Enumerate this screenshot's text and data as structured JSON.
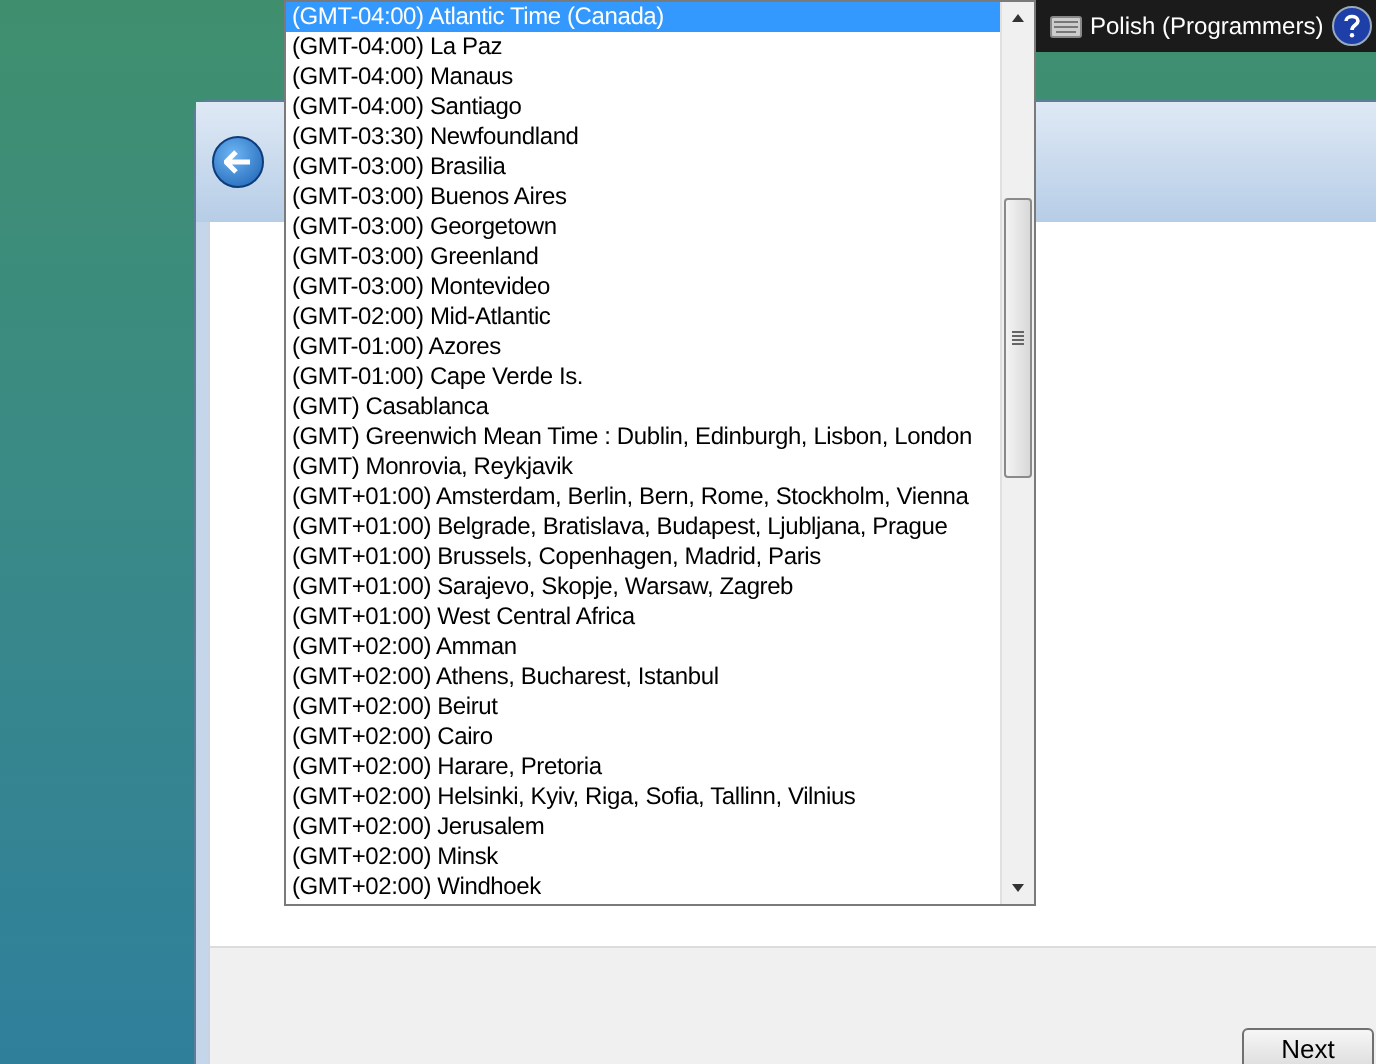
{
  "language_bar": {
    "label": "Polish (Programmers)"
  },
  "timezone_list": {
    "items": [
      {
        "label": "(GMT-04:00) Atlantic Time (Canada)",
        "selected": true
      },
      {
        "label": "(GMT-04:00) La Paz",
        "selected": false
      },
      {
        "label": "(GMT-04:00) Manaus",
        "selected": false
      },
      {
        "label": "(GMT-04:00) Santiago",
        "selected": false
      },
      {
        "label": "(GMT-03:30) Newfoundland",
        "selected": false
      },
      {
        "label": "(GMT-03:00) Brasilia",
        "selected": false
      },
      {
        "label": "(GMT-03:00) Buenos Aires",
        "selected": false
      },
      {
        "label": "(GMT-03:00) Georgetown",
        "selected": false
      },
      {
        "label": "(GMT-03:00) Greenland",
        "selected": false
      },
      {
        "label": "(GMT-03:00) Montevideo",
        "selected": false
      },
      {
        "label": "(GMT-02:00) Mid-Atlantic",
        "selected": false
      },
      {
        "label": "(GMT-01:00) Azores",
        "selected": false
      },
      {
        "label": "(GMT-01:00) Cape Verde Is.",
        "selected": false
      },
      {
        "label": "(GMT) Casablanca",
        "selected": false
      },
      {
        "label": "(GMT) Greenwich Mean Time : Dublin, Edinburgh, Lisbon, London",
        "selected": false
      },
      {
        "label": "(GMT) Monrovia, Reykjavik",
        "selected": false
      },
      {
        "label": "(GMT+01:00) Amsterdam, Berlin, Bern, Rome, Stockholm, Vienna",
        "selected": false
      },
      {
        "label": "(GMT+01:00) Belgrade, Bratislava, Budapest, Ljubljana, Prague",
        "selected": false
      },
      {
        "label": "(GMT+01:00) Brussels, Copenhagen, Madrid, Paris",
        "selected": false
      },
      {
        "label": "(GMT+01:00) Sarajevo, Skopje, Warsaw, Zagreb",
        "selected": false
      },
      {
        "label": "(GMT+01:00) West Central Africa",
        "selected": false
      },
      {
        "label": "(GMT+02:00) Amman",
        "selected": false
      },
      {
        "label": "(GMT+02:00) Athens, Bucharest, Istanbul",
        "selected": false
      },
      {
        "label": "(GMT+02:00) Beirut",
        "selected": false
      },
      {
        "label": "(GMT+02:00) Cairo",
        "selected": false
      },
      {
        "label": "(GMT+02:00) Harare, Pretoria",
        "selected": false
      },
      {
        "label": "(GMT+02:00) Helsinki, Kyiv, Riga, Sofia, Tallinn, Vilnius",
        "selected": false
      },
      {
        "label": "(GMT+02:00) Jerusalem",
        "selected": false
      },
      {
        "label": "(GMT+02:00) Minsk",
        "selected": false
      },
      {
        "label": "(GMT+02:00) Windhoek",
        "selected": false
      }
    ]
  },
  "buttons": [
    {
      "label": "Next"
    }
  ]
}
